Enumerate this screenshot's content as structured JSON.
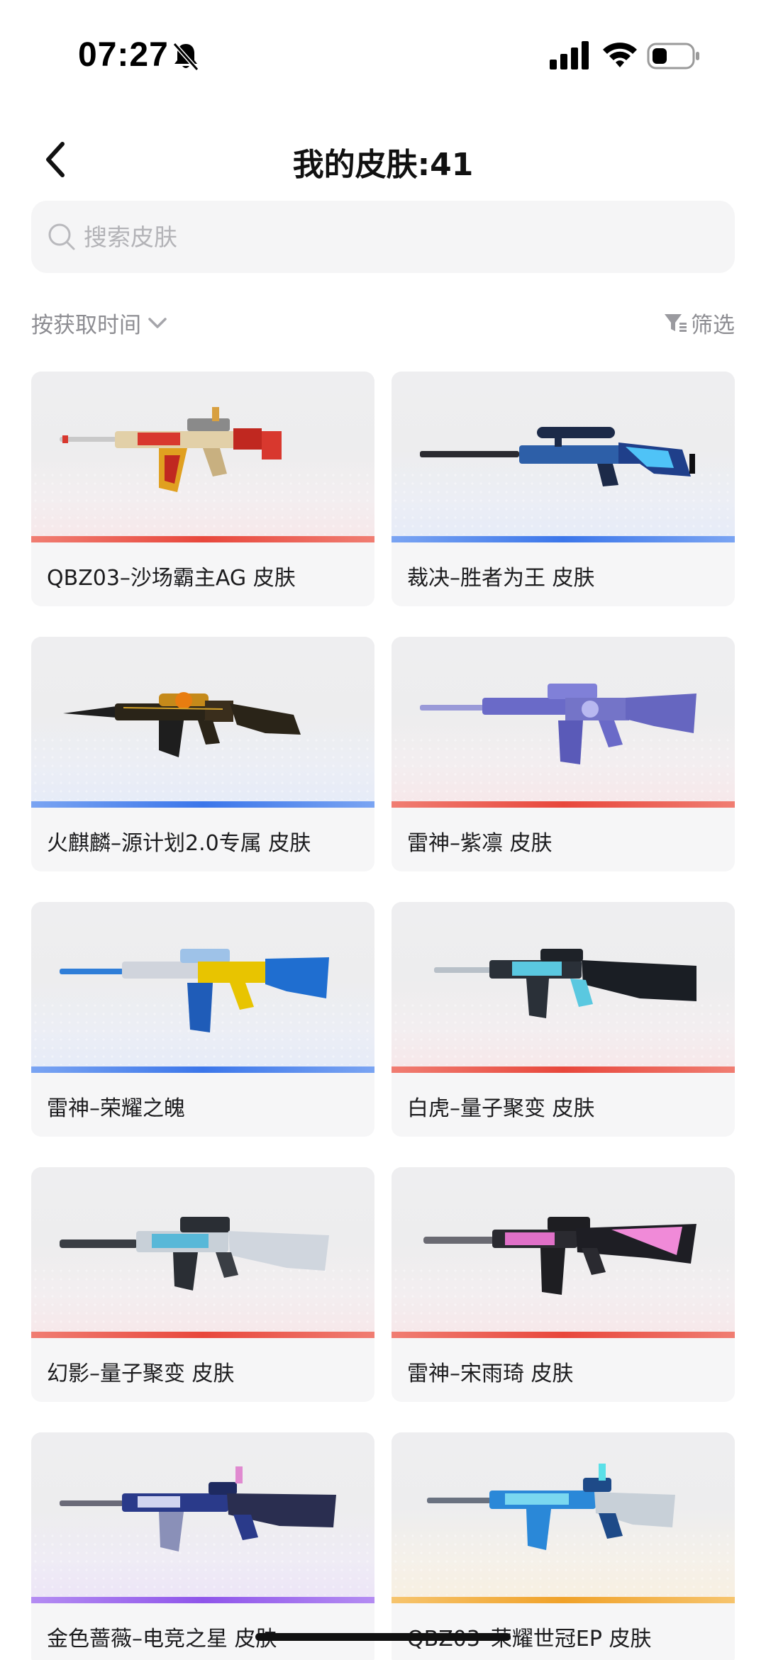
{
  "status_bar": {
    "time": "07:27",
    "icons": [
      "mute-icon",
      "signal-icon",
      "wifi-icon",
      "battery-icon"
    ]
  },
  "header": {
    "back_icon": "back-arrow-icon",
    "title": "我的皮肤:41"
  },
  "search": {
    "placeholder": "搜索皮肤",
    "value": ""
  },
  "sort": {
    "label": "按获取时间"
  },
  "filter": {
    "label": "筛选"
  },
  "colors": {
    "red_bar": "#e8473c",
    "blue_bar": "#3b76ea",
    "purple_bar": "#8f55ea",
    "gold_bar": "#f0a22a",
    "label_gray": "#8d8d92"
  },
  "skins": [
    {
      "label": "QBZ03–沙场霸主AG 皮肤",
      "rarity_color": "red",
      "weapon": "rifle-red-gold"
    },
    {
      "label": "裁决–胜者为王 皮肤",
      "rarity_color": "blue",
      "weapon": "sniper-blue"
    },
    {
      "label": "火麒麟–源计划2.0专属 皮肤",
      "rarity_color": "blue",
      "weapon": "ak-black-gold"
    },
    {
      "label": "雷神–紫凛 皮肤",
      "rarity_color": "red",
      "weapon": "m4-purple"
    },
    {
      "label": "雷神–荣耀之魄",
      "rarity_color": "blue",
      "weapon": "m4-blue-yellow"
    },
    {
      "label": "白虎–量子聚变 皮肤",
      "rarity_color": "red",
      "weapon": "scar-cyan-black"
    },
    {
      "label": "幻影–量子聚变 皮肤",
      "rarity_color": "red",
      "weapon": "g36-cyan-silver"
    },
    {
      "label": "雷神–宋雨琦 皮肤",
      "rarity_color": "red",
      "weapon": "m4-pink-black"
    },
    {
      "label": "金色蔷薇–电竞之星 皮肤",
      "rarity_color": "purple",
      "weapon": "qbz-navy"
    },
    {
      "label": "QBZ03–荣耀世冠EP 皮肤",
      "rarity_color": "gold",
      "weapon": "qbz-cyan"
    }
  ]
}
